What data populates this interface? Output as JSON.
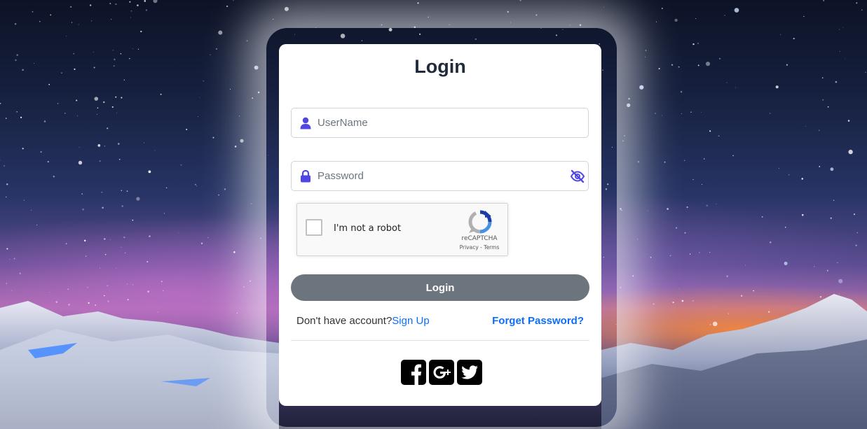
{
  "login": {
    "title": "Login",
    "username": {
      "placeholder": "UserName",
      "icon": "user-icon"
    },
    "password": {
      "placeholder": "Password",
      "icon": "lock-icon",
      "toggle_icon": "eye-slash-icon"
    },
    "captcha": {
      "label": "I'm not a robot",
      "brand": "reCAPTCHA",
      "privacy": "Privacy",
      "separator": " - ",
      "terms": "Terms"
    },
    "submit_label": "Login",
    "no_account_text": "Don't have account?",
    "signup_label": "Sign Up",
    "forgot_label": "Forget Password?",
    "social": [
      "facebook-icon",
      "google-plus-icon",
      "twitter-icon"
    ]
  },
  "colors": {
    "accent": "#4f46e5",
    "link": "#0d6efd",
    "button": "#6c757d"
  }
}
